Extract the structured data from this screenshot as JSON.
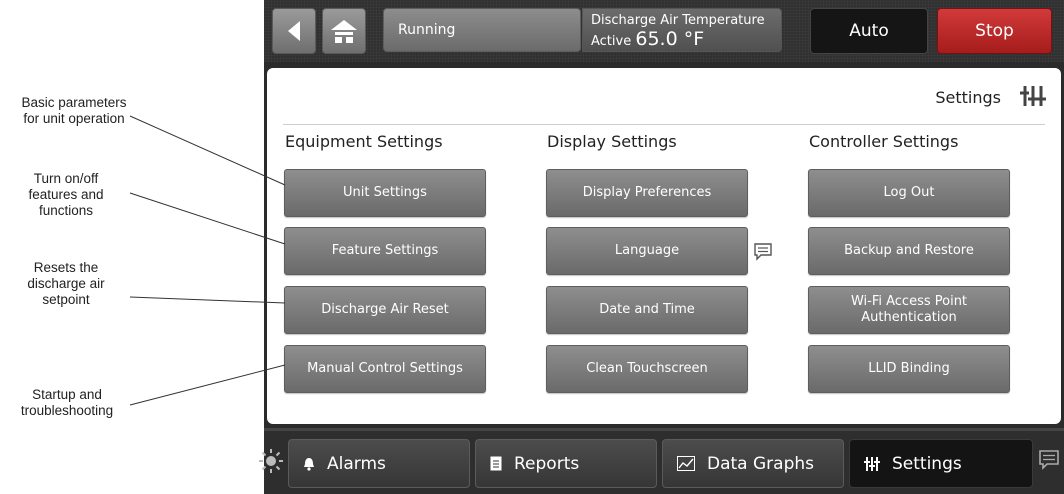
{
  "annotations": [
    {
      "id": "basic",
      "text": "Basic parameters\nfor unit operation"
    },
    {
      "id": "turn",
      "text": "Turn on/off\nfeatures and\nfunctions"
    },
    {
      "id": "resets",
      "text": "Resets the\ndischarge air\nsetpoint"
    },
    {
      "id": "startup",
      "text": "Startup and\ntroubleshooting"
    }
  ],
  "topbar": {
    "status": "Running",
    "dat_label": "Discharge Air Temperature",
    "dat_state": "Active",
    "dat_value": "65.0 °F",
    "auto_label": "Auto",
    "stop_label": "Stop",
    "colors": {
      "stop": "#c0292b",
      "auto": "#151515"
    }
  },
  "panel": {
    "title": "Settings",
    "columns": [
      {
        "heading": "Equipment Settings",
        "buttons": [
          "Unit Settings",
          "Feature Settings",
          "Discharge Air Reset",
          "Manual Control Settings"
        ]
      },
      {
        "heading": "Display Settings",
        "buttons": [
          "Display Preferences",
          "Language",
          "Date and Time",
          "Clean Touchscreen"
        ]
      },
      {
        "heading": "Controller Settings",
        "buttons": [
          "Log Out",
          "Backup and Restore",
          "Wi-Fi Access Point Authentication",
          "LLID Binding"
        ]
      }
    ]
  },
  "bottom_tabs": [
    {
      "label": "Alarms",
      "icon": "bell-icon"
    },
    {
      "label": "Reports",
      "icon": "document-icon"
    },
    {
      "label": "Data Graphs",
      "icon": "graph-icon"
    },
    {
      "label": "Settings",
      "icon": "sliders-icon",
      "active": true
    }
  ]
}
